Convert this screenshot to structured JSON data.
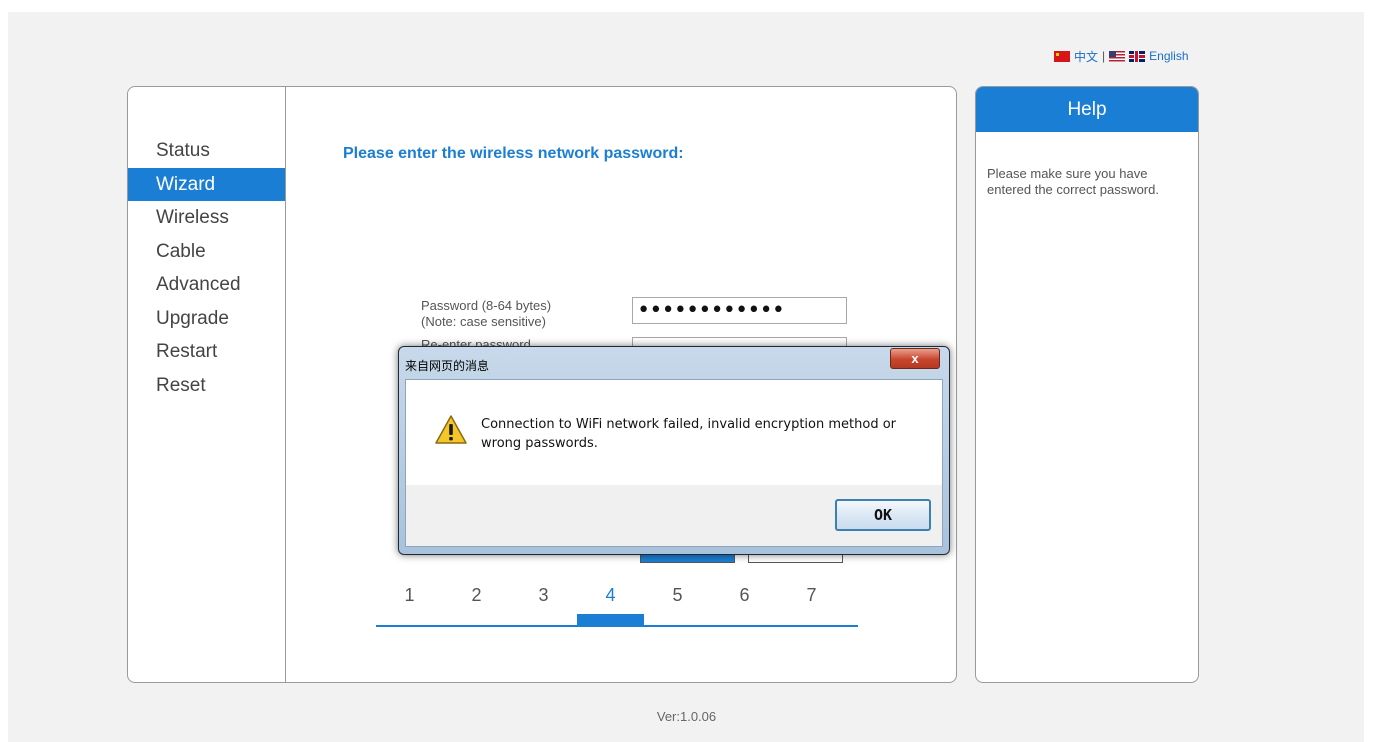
{
  "language": {
    "chinese_label": "中文",
    "separator": "|",
    "english_label": "English"
  },
  "sidebar": {
    "items": [
      {
        "label": "Status",
        "active": false
      },
      {
        "label": "Wizard",
        "active": true
      },
      {
        "label": "Wireless",
        "active": false
      },
      {
        "label": "Cable",
        "active": false
      },
      {
        "label": "Advanced",
        "active": false
      },
      {
        "label": "Upgrade",
        "active": false
      },
      {
        "label": "Restart",
        "active": false
      },
      {
        "label": "Reset",
        "active": false
      }
    ]
  },
  "main": {
    "title": "Please enter the wireless network password:",
    "password_label_line1": "Password (8-64 bytes)",
    "password_label_line2": "(Note: case sensitive)",
    "reenter_label": "Re-enter password",
    "password_value": "••••••••••••",
    "steps": [
      "1",
      "2",
      "3",
      "4",
      "5",
      "6",
      "7"
    ],
    "active_step": "4"
  },
  "help": {
    "title": "Help",
    "text": "Please make sure you have entered the correct password."
  },
  "footer": {
    "version": "Ver:1.0.06"
  },
  "dialog": {
    "title": "来自网页的消息",
    "close_label": "x",
    "message": "Connection to WiFi network failed, invalid encryption method or wrong passwords.",
    "ok_label": "OK"
  },
  "colors": {
    "accent": "#1a7fd4",
    "dialog_frame": "#a9c2dc",
    "close_red": "#c9452d"
  }
}
